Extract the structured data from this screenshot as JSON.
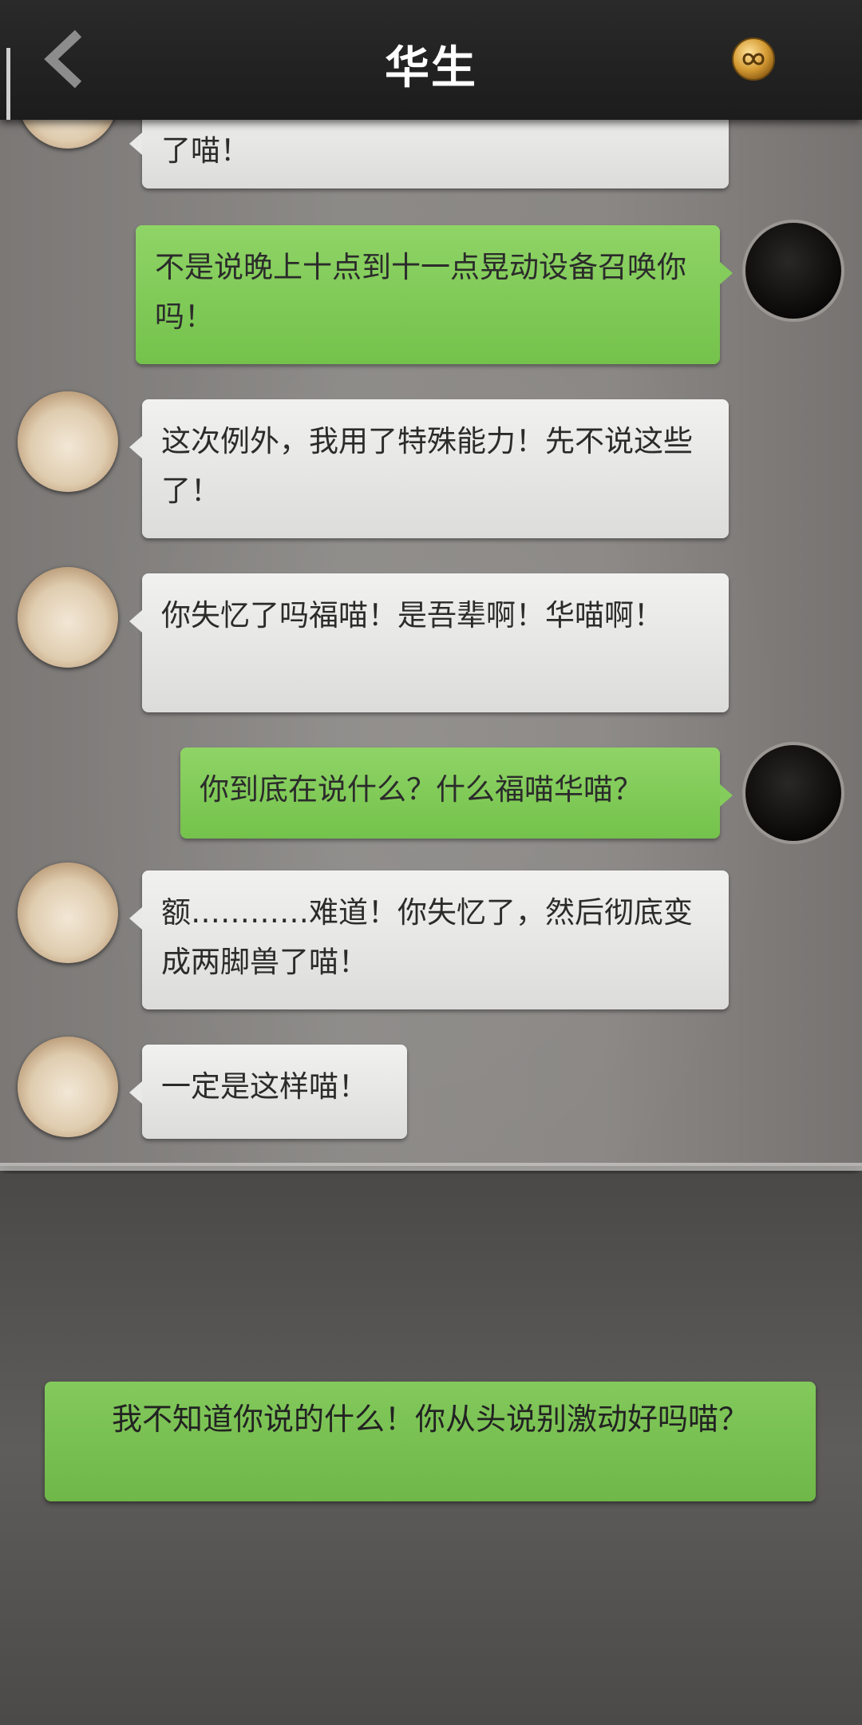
{
  "header": {
    "title": "华生",
    "back_icon": "chevron-left-icon",
    "coin_icon": "infinity-coin-icon"
  },
  "messages": [
    {
      "side": "left",
      "speaker": "cat",
      "text": "了喵！"
    },
    {
      "side": "right",
      "speaker": "player",
      "text": "不是说晚上十点到十一点晃动设备召唤你吗！"
    },
    {
      "side": "left",
      "speaker": "cat",
      "text": "这次例外，我用了特殊能力！先不说这些了！"
    },
    {
      "side": "left",
      "speaker": "cat",
      "text": "你失忆了吗福喵！是吾辈啊！华喵啊！"
    },
    {
      "side": "right",
      "speaker": "player",
      "text": "你到底在说什么？什么福喵华喵？"
    },
    {
      "side": "left",
      "speaker": "cat",
      "text": "额…………难道！你失忆了，然后彻底变成两脚兽了喵！"
    },
    {
      "side": "left",
      "speaker": "cat",
      "text": "一定是这样喵！"
    }
  ],
  "reply_option": {
    "text": "我不知道你说的什么！你从头说别激动好吗喵？"
  },
  "colors": {
    "green_bubble": "#84cc5c",
    "white_bubble": "#e9e9e7",
    "topbar": "#1f1f1f"
  }
}
